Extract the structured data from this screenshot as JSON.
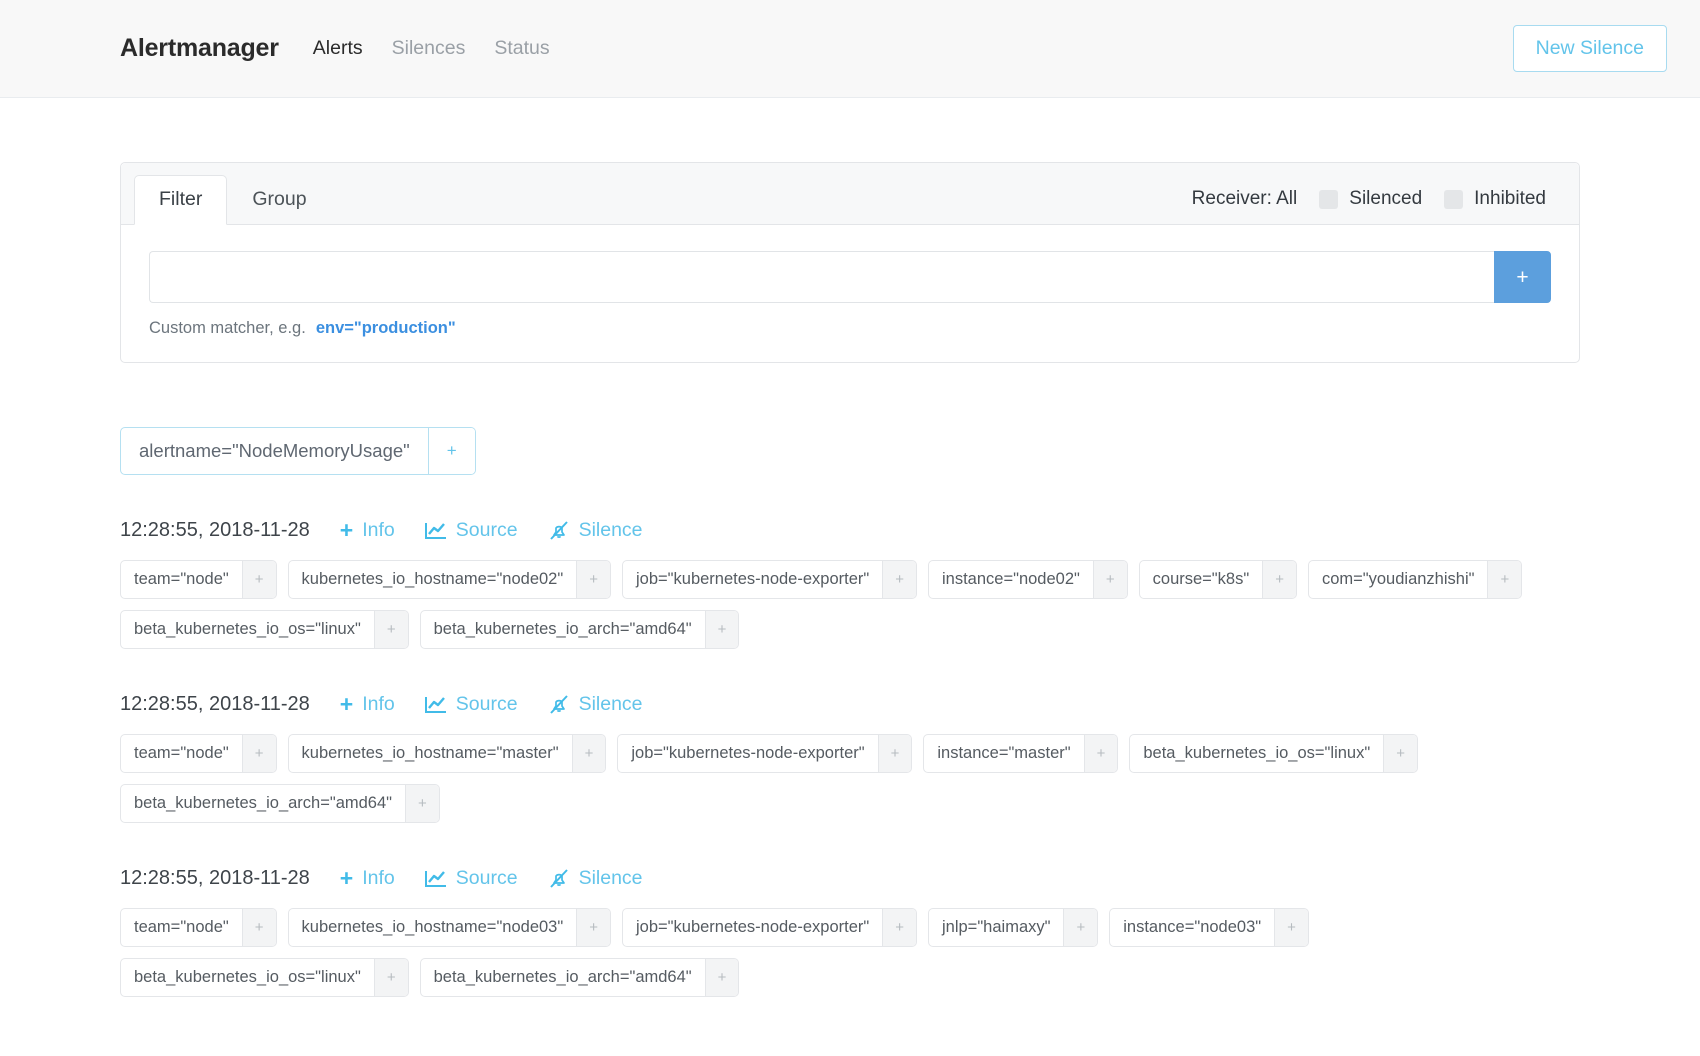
{
  "navbar": {
    "brand": "Alertmanager",
    "links": [
      {
        "label": "Alerts",
        "active": true
      },
      {
        "label": "Silences",
        "active": false
      },
      {
        "label": "Status",
        "active": false
      }
    ],
    "new_silence_label": "New Silence",
    "accent_color": "#63c4ea"
  },
  "filter_panel": {
    "tabs": [
      {
        "label": "Filter",
        "active": true
      },
      {
        "label": "Group",
        "active": false
      }
    ],
    "receiver_label": "Receiver: All",
    "toggles": [
      {
        "label": "Silenced",
        "checked": false
      },
      {
        "label": "Inhibited",
        "checked": false
      }
    ],
    "matcher_input_value": "",
    "matcher_input_placeholder": "",
    "add_button_label": "+",
    "helper_prefix": "Custom matcher, e.g.",
    "helper_example": "env=\"production\"",
    "add_button_color": "#5c9fdd"
  },
  "group": {
    "chip_label": "alertname=\"NodeMemoryUsage\"",
    "chip_plus": "+",
    "chip_border_color": "#b5e0f1"
  },
  "alerts": [
    {
      "time": "12:28:55, 2018-11-28",
      "actions": [
        {
          "label": "Info",
          "icon": "plus-icon"
        },
        {
          "label": "Source",
          "icon": "chart-line-icon"
        },
        {
          "label": "Silence",
          "icon": "bell-slash-icon"
        }
      ],
      "labels": [
        "team=\"node\"",
        "kubernetes_io_hostname=\"node02\"",
        "job=\"kubernetes-node-exporter\"",
        "instance=\"node02\"",
        "course=\"k8s\"",
        "com=\"youdianzhishi\"",
        "beta_kubernetes_io_os=\"linux\"",
        "beta_kubernetes_io_arch=\"amd64\""
      ]
    },
    {
      "time": "12:28:55, 2018-11-28",
      "actions": [
        {
          "label": "Info",
          "icon": "plus-icon"
        },
        {
          "label": "Source",
          "icon": "chart-line-icon"
        },
        {
          "label": "Silence",
          "icon": "bell-slash-icon"
        }
      ],
      "labels": [
        "team=\"node\"",
        "kubernetes_io_hostname=\"master\"",
        "job=\"kubernetes-node-exporter\"",
        "instance=\"master\"",
        "beta_kubernetes_io_os=\"linux\"",
        "beta_kubernetes_io_arch=\"amd64\""
      ]
    },
    {
      "time": "12:28:55, 2018-11-28",
      "actions": [
        {
          "label": "Info",
          "icon": "plus-icon"
        },
        {
          "label": "Source",
          "icon": "chart-line-icon"
        },
        {
          "label": "Silence",
          "icon": "bell-slash-icon"
        }
      ],
      "labels": [
        "team=\"node\"",
        "kubernetes_io_hostname=\"node03\"",
        "job=\"kubernetes-node-exporter\"",
        "jnlp=\"haimaxy\"",
        "instance=\"node03\"",
        "beta_kubernetes_io_os=\"linux\"",
        "beta_kubernetes_io_arch=\"amd64\""
      ]
    }
  ],
  "label_plus": "+"
}
